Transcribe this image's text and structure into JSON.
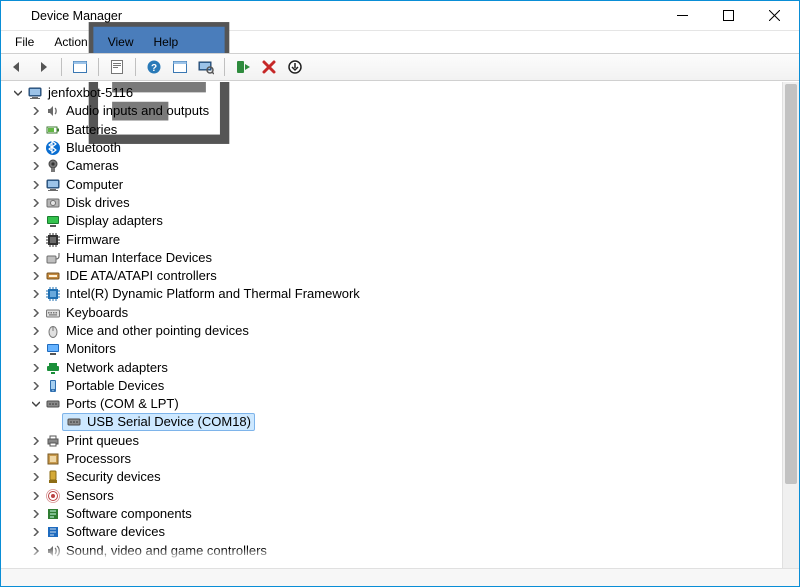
{
  "window": {
    "title": "Device Manager"
  },
  "menu": {
    "file": "File",
    "action": "Action",
    "view": "View",
    "help": "Help"
  },
  "tree": {
    "root": "jenfoxbot-5116",
    "items": [
      {
        "label": "Audio inputs and outputs",
        "icon": "speaker"
      },
      {
        "label": "Batteries",
        "icon": "battery"
      },
      {
        "label": "Bluetooth",
        "icon": "bluetooth"
      },
      {
        "label": "Cameras",
        "icon": "camera"
      },
      {
        "label": "Computer",
        "icon": "computer"
      },
      {
        "label": "Disk drives",
        "icon": "disk"
      },
      {
        "label": "Display adapters",
        "icon": "display"
      },
      {
        "label": "Firmware",
        "icon": "firmware"
      },
      {
        "label": "Human Interface Devices",
        "icon": "hid"
      },
      {
        "label": "IDE ATA/ATAPI controllers",
        "icon": "ide"
      },
      {
        "label": "Intel(R) Dynamic Platform and Thermal Framework",
        "icon": "chip"
      },
      {
        "label": "Keyboards",
        "icon": "keyboard"
      },
      {
        "label": "Mice and other pointing devices",
        "icon": "mouse"
      },
      {
        "label": "Monitors",
        "icon": "monitor"
      },
      {
        "label": "Network adapters",
        "icon": "network"
      },
      {
        "label": "Portable Devices",
        "icon": "portable"
      },
      {
        "label": "Ports (COM & LPT)",
        "icon": "port",
        "expanded": true,
        "children": [
          {
            "label": "USB Serial Device (COM18)",
            "icon": "port",
            "selected": true
          }
        ]
      },
      {
        "label": "Print queues",
        "icon": "printer"
      },
      {
        "label": "Processors",
        "icon": "cpu"
      },
      {
        "label": "Security devices",
        "icon": "security"
      },
      {
        "label": "Sensors",
        "icon": "sensor"
      },
      {
        "label": "Software components",
        "icon": "swcomp"
      },
      {
        "label": "Software devices",
        "icon": "swdev"
      },
      {
        "label": "Sound, video and game controllers",
        "icon": "sound"
      }
    ]
  }
}
